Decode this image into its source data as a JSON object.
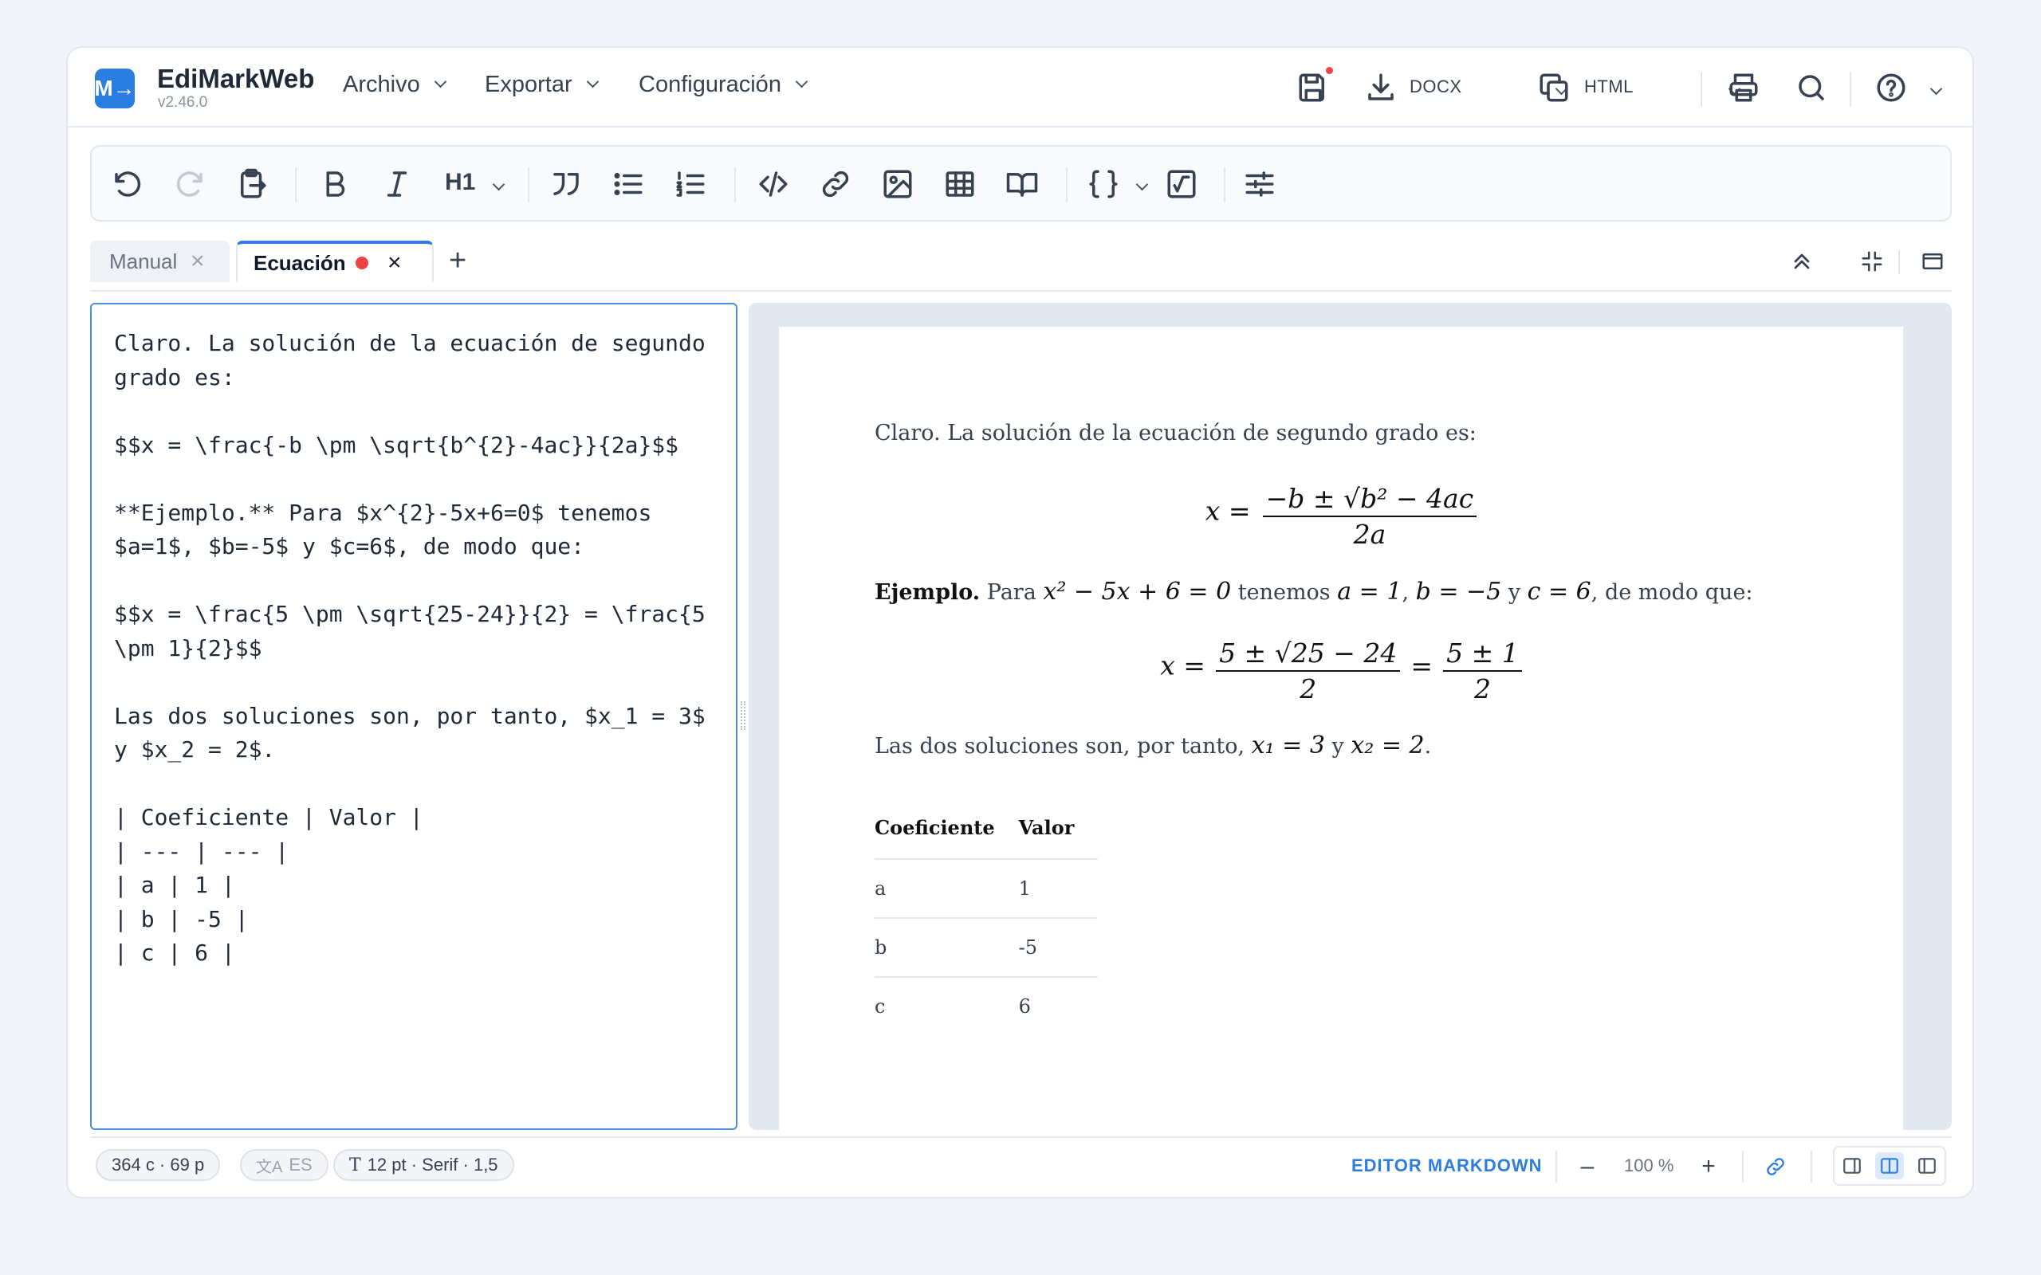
{
  "app": {
    "logo": "M→",
    "title": "EdiMarkWeb",
    "version": "v2.46.0"
  },
  "menu": {
    "archivo": "Archivo",
    "exportar": "Exportar",
    "configuracion": "Configuración"
  },
  "header_actions": {
    "docx_label": "DOCX",
    "html_label": "HTML"
  },
  "toolbar": {
    "heading_label": "H1"
  },
  "tabs": [
    {
      "label": "Manual"
    },
    {
      "label": "Ecuación"
    }
  ],
  "editor": {
    "text": "Claro. La solución de la ecuación de segundo grado es:\n\n$$x = \\frac{-b \\pm \\sqrt{b^{2}-4ac}}{2a}$$\n\n**Ejemplo.** Para $x^{2}-5x+6=0$ tenemos $a=1$, $b=-5$ y $c=6$, de modo que:\n\n$$x = \\frac{5 \\pm \\sqrt{25-24}}{2} = \\frac{5 \\pm 1}{2}$$\n\nLas dos soluciones son, por tanto, $x_1 = 3$ y $x_2 = 2$.\n\n| Coeficiente | Valor |\n| --- | --- |\n| a | 1 |\n| b | -5 |\n| c | 6 |"
  },
  "preview": {
    "intro": "Claro. La solución de la ecuación de segundo grado es:",
    "formula1": {
      "lhs": "x =",
      "num": "−b ± √b² − 4ac",
      "den": "2a"
    },
    "example_bold": "Ejemplo.",
    "example_text1": " Para ",
    "example_math1": "x² − 5x + 6 = 0",
    "example_text2": " tenemos ",
    "example_math2": "a = 1",
    "example_text3": ", ",
    "example_math3": "b = −5",
    "example_text4": " y ",
    "example_math4": "c = 6",
    "example_text5": ", de modo que:",
    "formula2": {
      "lhs": "x =",
      "num1": "5 ± √25 − 24",
      "den1": "2",
      "eq": "=",
      "num2": "5 ± 1",
      "den2": "2"
    },
    "solutions_text1": "Las dos soluciones son, por tanto, ",
    "solutions_math1": "x₁ = 3",
    "solutions_text2": " y ",
    "solutions_math2": "x₂ = 2",
    "solutions_text3": ".",
    "table": {
      "headers": [
        "Coeficiente",
        "Valor"
      ],
      "rows": [
        [
          "a",
          "1"
        ],
        [
          "b",
          "-5"
        ],
        [
          "c",
          "6"
        ]
      ]
    }
  },
  "status": {
    "count": "364 c · 69 p",
    "language": "ES",
    "font": "12 pt · Serif · 1,5",
    "mode": "EDITOR MARKDOWN",
    "zoom": "100 %",
    "zoom_out": "–",
    "zoom_in": "+"
  },
  "colors": {
    "accent": "#2b7de0",
    "unsaved_dot": "#ef4444"
  }
}
